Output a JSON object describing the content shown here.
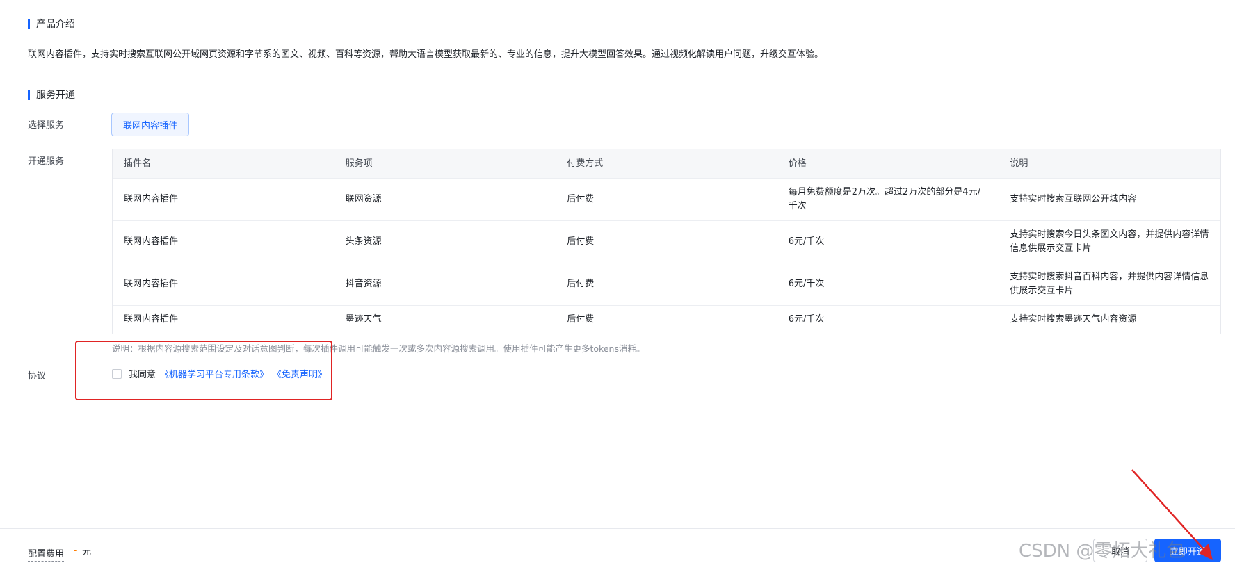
{
  "intro": {
    "heading": "产品介绍",
    "text": "联网内容插件，支持实时搜索互联网公开域网页资源和字节系的图文、视频、百科等资源，帮助大语言模型获取最新的、专业的信息，提升大模型回答效果。通过视频化解读用户问题，升级交互体验。"
  },
  "service": {
    "heading": "服务开通",
    "select_label": "选择服务",
    "selected_chip": "联网内容插件",
    "open_label": "开通服务"
  },
  "table": {
    "headers": [
      "插件名",
      "服务项",
      "付费方式",
      "价格",
      "说明"
    ],
    "rows": [
      [
        "联网内容插件",
        "联网资源",
        "后付费",
        "每月免费额度是2万次。超过2万次的部分是4元/千次",
        "支持实时搜索互联网公开域内容"
      ],
      [
        "联网内容插件",
        "头条资源",
        "后付费",
        "6元/千次",
        "支持实时搜索今日头条图文内容，并提供内容详情信息供展示交互卡片"
      ],
      [
        "联网内容插件",
        "抖音资源",
        "后付费",
        "6元/千次",
        "支持实时搜索抖音百科内容，并提供内容详情信息供展示交互卡片"
      ],
      [
        "联网内容插件",
        "墨迹天气",
        "后付费",
        "6元/千次",
        "支持实时搜索墨迹天气内容资源"
      ]
    ]
  },
  "note": "说明：根据内容源搜索范围设定及对话意图判断，每次插件调用可能触发一次或多次内容源搜索调用。使用插件可能产生更多tokens消耗。",
  "agreement": {
    "label": "协议",
    "agree_text": "我同意",
    "link1": "《机器学习平台专用条款》",
    "link2": "《免责声明》",
    "checked": false
  },
  "footer": {
    "fee_label": "配置费用",
    "fee_value": "-",
    "fee_unit": "元",
    "cancel_label": "取消",
    "open_label": "立即开通"
  },
  "watermark": "CSDN @零炻大礼包",
  "colors": {
    "accent": "#1664ff",
    "annotation": "#e02424",
    "fee_dash": "#ff7d00"
  }
}
